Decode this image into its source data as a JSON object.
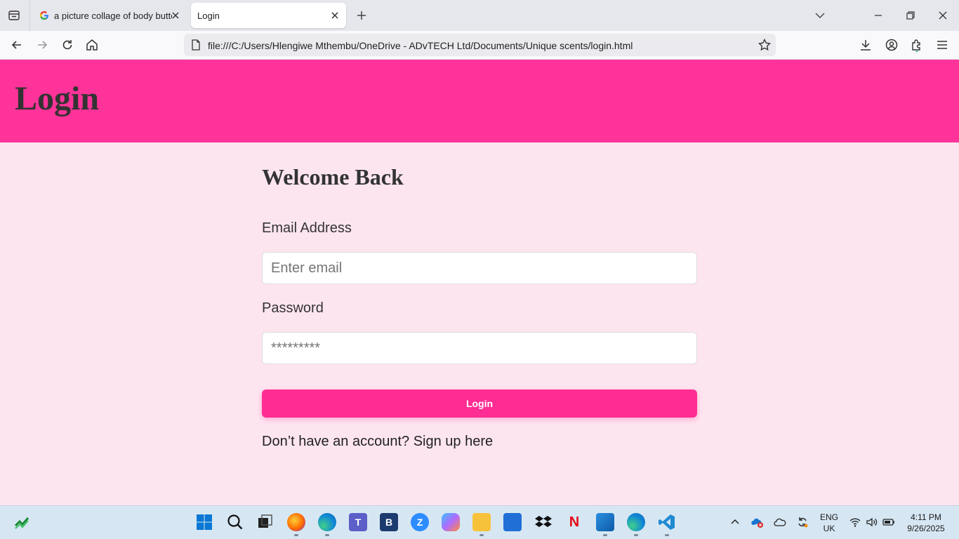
{
  "browser": {
    "tabs": [
      {
        "title": "a picture collage of body butter",
        "favicon": "google-g-icon",
        "active": false
      },
      {
        "title": "Login",
        "active": true
      }
    ],
    "url": "file:///C:/Users/Hlengiwe Mthembu/OneDrive - ADvTECH Ltd/Documents/Unique scents/login.html"
  },
  "page": {
    "header_title": "Login",
    "welcome": "Welcome Back",
    "email_label": "Email Address",
    "email_placeholder": "Enter email",
    "password_label": "Password",
    "password_value": "*********",
    "login_button": "Login",
    "signup_text": "Don’t have an account? Sign up here"
  },
  "taskbar": {
    "language": "ENG",
    "region": "UK",
    "time": "4:11 PM",
    "date": "9/26/2025"
  },
  "colors": {
    "header_bg": "#ff3399",
    "page_bg": "#fde5f0",
    "button_bg": "#ff2d93",
    "text": "#333333"
  }
}
